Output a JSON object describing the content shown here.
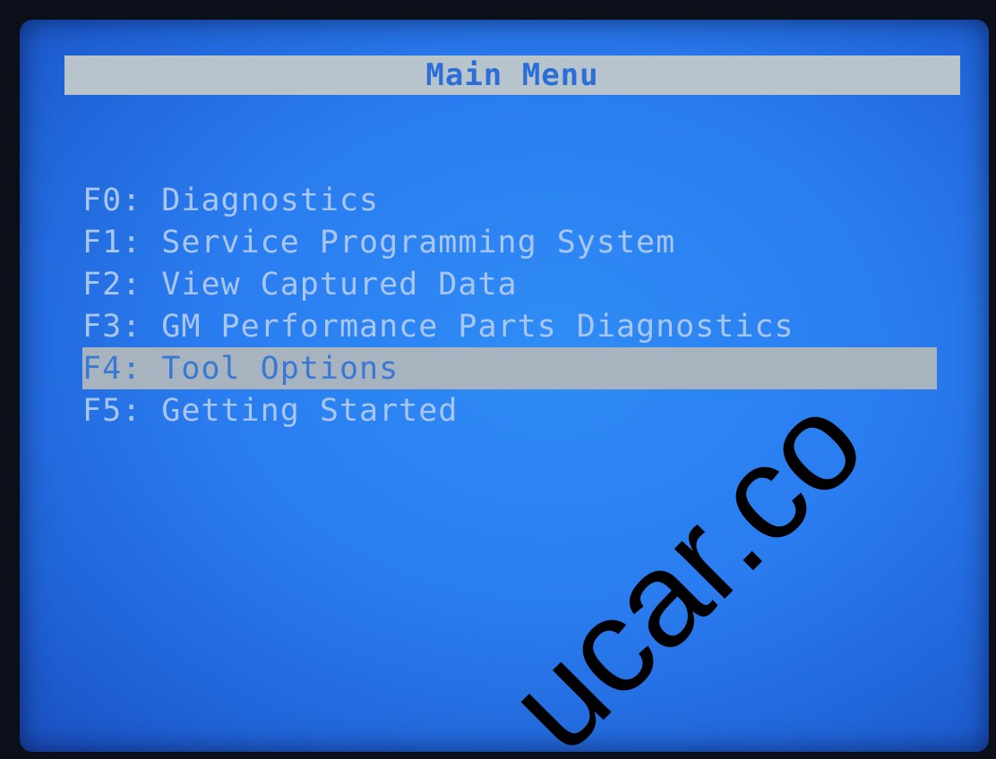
{
  "title": "Main Menu",
  "menu": {
    "items": [
      {
        "key": "F0:",
        "label": "Diagnostics"
      },
      {
        "key": "F1:",
        "label": "Service Programming System"
      },
      {
        "key": "F2:",
        "label": "View Captured Data"
      },
      {
        "key": "F3:",
        "label": "GM Performance Parts Diagnostics"
      },
      {
        "key": "F4:",
        "label": "Tool Options"
      },
      {
        "key": "F5:",
        "label": "Getting Started"
      }
    ],
    "selected_index": 4
  },
  "watermark": "ucar.co",
  "colors": {
    "screen_background": "#2a7df0",
    "title_bar": "#b7c4cc",
    "title_text": "#2b6ed8",
    "menu_text": "#a9c6ef",
    "selected_bar": "#a7b4bf",
    "selected_text": "#3a78d6"
  }
}
